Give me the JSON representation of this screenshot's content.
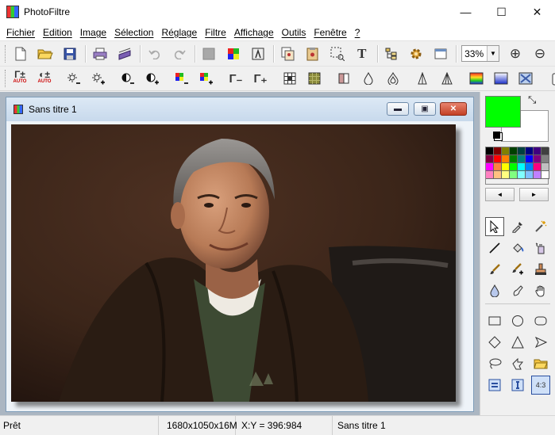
{
  "window": {
    "title": "PhotoFiltre",
    "minimize_glyph": "—",
    "maximize_glyph": "☐",
    "close_glyph": "✕"
  },
  "menu": [
    "Fichier",
    "Edition",
    "Image",
    "Sélection",
    "Réglage",
    "Filtre",
    "Affichage",
    "Outils",
    "Fenêtre",
    "?"
  ],
  "toolbar1": {
    "text_tool_glyph": "T",
    "zoom_value": "33%",
    "zoom_arrow": "▼",
    "zoom_in_glyph": "⊕",
    "zoom_out_glyph": "⊖"
  },
  "toolbar2": {
    "gamma_auto_label": "Γ±",
    "contrast_auto_label": "◐±",
    "auto_text": "AUTO",
    "gamma_minus": "Γ₋",
    "gamma_plus": "Γ₊"
  },
  "document": {
    "title": "Sans titre 1",
    "min_glyph": "▬",
    "restore_glyph": "▣",
    "close_glyph": "✕"
  },
  "palette_nav": {
    "prev": "◄",
    "next": "►"
  },
  "status": {
    "state": "Prêt",
    "size": "1680x1050x16M",
    "coords": "X:Y = 396:984",
    "doc_name": "Sans titre 1"
  },
  "colors": {
    "foreground": "#00ff00",
    "background": "#ffffff",
    "palette": [
      "#000000",
      "#800000",
      "#808000",
      "#004000",
      "#004040",
      "#000080",
      "#400080",
      "#404040",
      "#800040",
      "#ff0000",
      "#ff8000",
      "#008000",
      "#008080",
      "#0000ff",
      "#800080",
      "#808080",
      "#ff00ff",
      "#ff8040",
      "#ffff00",
      "#00ff00",
      "#00ffff",
      "#0080ff",
      "#ff0080",
      "#c0c0c0",
      "#ff80c0",
      "#ffc080",
      "#ffff80",
      "#80ff80",
      "#80ffff",
      "#80c0ff",
      "#c080ff",
      "#ffffff"
    ]
  },
  "icons": {
    "toolbar1": [
      "new-file-icon",
      "open-folder-icon",
      "save-disk-icon",
      "print-icon",
      "scan-icon",
      "undo-icon",
      "redo-icon",
      "grayscale-icon",
      "rgb-icon",
      "mask-icon",
      "copy-image-icon",
      "paste-image-icon",
      "selection-icon",
      "text-icon",
      "layers-icon",
      "plugin-gear-icon",
      "window-icon",
      "zoom-in-icon",
      "zoom-out-icon"
    ],
    "toolbar2": [
      "gamma-auto-icon",
      "contrast-auto-icon",
      "brightness-minus-icon",
      "brightness-plus-icon",
      "contrast-minus-icon",
      "contrast-plus-icon",
      "saturation-minus-icon",
      "saturation-plus-icon",
      "gamma-minus-icon",
      "gamma-plus-icon",
      "sharpen-icon",
      "emboss-icon",
      "blur-icon",
      "water-drop-icon",
      "drops-icon",
      "pyramid-icon",
      "pyramid-outline-icon",
      "gradient-icon",
      "gradient-blue-icon",
      "texture-icon"
    ],
    "tools": [
      "arrow-select-icon",
      "eyedropper-icon",
      "magic-wand-icon",
      "line-icon",
      "fill-bucket-icon",
      "spray-icon",
      "brush-icon",
      "brush-plus-icon",
      "stamp-icon",
      "drop-blur-icon",
      "finger-smudge-icon",
      "hand-pan-icon",
      "rectangle-icon",
      "ellipse-icon",
      "rounded-rect-icon",
      "rhombus-icon",
      "triangle-icon",
      "arrow-shape-icon",
      "lasso-icon",
      "polygon-icon",
      "open-shape-icon",
      "fill-mode-icon",
      "text-frame-icon",
      "ratio-icon"
    ]
  }
}
